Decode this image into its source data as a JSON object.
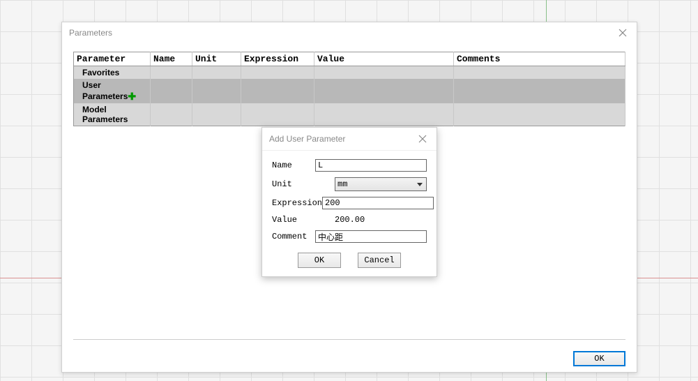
{
  "mainDialog": {
    "title": "Parameters",
    "columns": {
      "parameter": "Parameter",
      "name": "Name",
      "unit": "Unit",
      "expression": "Expression",
      "value": "Value",
      "comments": "Comments"
    },
    "rows": [
      {
        "label": "Favorites",
        "shade": "light",
        "hasPlus": false
      },
      {
        "label": "User Parameters",
        "shade": "med",
        "hasPlus": true
      },
      {
        "label": "Model Parameters",
        "shade": "light",
        "hasPlus": false
      }
    ],
    "okLabel": "OK"
  },
  "subDialog": {
    "title": "Add User Parameter",
    "labels": {
      "name": "Name",
      "unit": "Unit",
      "expression": "Expression",
      "value": "Value",
      "comment": "Comment"
    },
    "fields": {
      "name": "L",
      "unit": "mm",
      "expression": "200",
      "value": "200.00",
      "comment": "中心距"
    },
    "okLabel": "OK",
    "cancelLabel": "Cancel"
  }
}
